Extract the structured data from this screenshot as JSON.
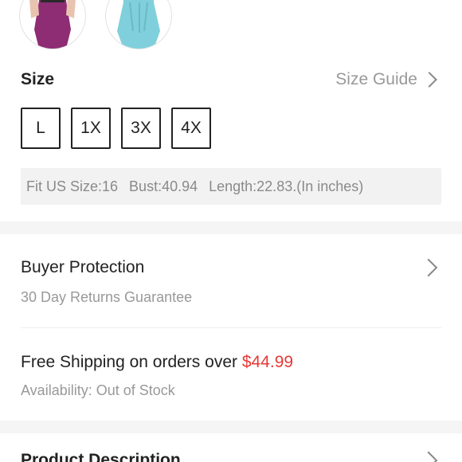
{
  "size": {
    "title": "Size",
    "guide_label": "Size Guide",
    "options": [
      "L",
      "1X",
      "3X",
      "4X"
    ],
    "fit_info": {
      "fit": "Fit US Size:16",
      "bust": "Bust:40.94",
      "length": "Length:22.83.(In inches)"
    }
  },
  "buyer_protection": {
    "title": "Buyer Protection",
    "subtitle": "30 Day Returns Guarantee"
  },
  "shipping": {
    "title_prefix": "Free Shipping on orders over ",
    "threshold": "$44.99",
    "availability": "Availability: Out of Stock"
  },
  "product_description": {
    "title": "Product Description"
  },
  "colors": {
    "accent_price": "#e53935",
    "swatch_purple": "#8e2c74",
    "swatch_teal": "#7fd0dc"
  }
}
